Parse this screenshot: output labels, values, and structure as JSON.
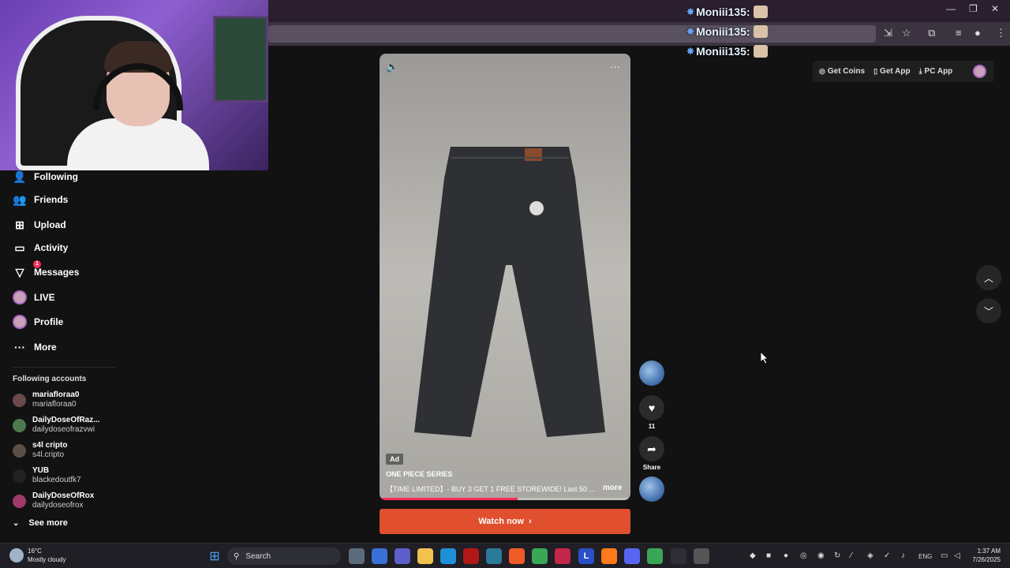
{
  "chat": {
    "lines": [
      {
        "user": "Moniii135:"
      },
      {
        "user": "Moniii135:"
      },
      {
        "user": "Moniii135:"
      }
    ]
  },
  "sidebar": {
    "items": [
      {
        "label": "Following",
        "icon": "person-check-icon"
      },
      {
        "label": "Friends",
        "icon": "friends-icon"
      },
      {
        "label": "Upload",
        "icon": "upload-icon"
      },
      {
        "label": "Activity",
        "icon": "activity-icon"
      },
      {
        "label": "Messages",
        "icon": "messages-icon",
        "badge": "1"
      },
      {
        "label": "LIVE",
        "icon": "live-icon"
      },
      {
        "label": "Profile",
        "icon": "profile-icon"
      },
      {
        "label": "More",
        "icon": "ellipsis-icon"
      }
    ],
    "following_label": "Following accounts",
    "accounts": [
      {
        "name": "mariafloraa0",
        "username": "mariafloraa0"
      },
      {
        "name": "DailyDoseOfRaz...",
        "username": "dailydoseofrazvwi"
      },
      {
        "name": "s4l cripto",
        "username": "s4l.cripto"
      },
      {
        "name": "YUB",
        "username": "blackedoutfk7"
      },
      {
        "name": "DailyDoseOfRox",
        "username": "dailydoseofrox"
      }
    ],
    "see_more": "See more"
  },
  "video": {
    "ad_label": "Ad",
    "title": "ONE PIECE SERIES",
    "description": "【TIME LIMITED】- BUY 3 GET 1 FREE STOREWIDE! Last 50 ...",
    "more": "more",
    "progress": 0.55,
    "cta": "Watch now"
  },
  "actions": {
    "like_count": "11",
    "share_label": "Share"
  },
  "topbar": {
    "get_coins": "Get Coins",
    "get_app": "Get App",
    "pc_app": "PC App"
  },
  "taskbar": {
    "weather_temp": "16°C",
    "weather_desc": "Mostly cloudy",
    "search_label": "Search",
    "lang": "ENG",
    "time": "1:37 AM",
    "date": "7/26/2025"
  },
  "colors": {
    "accent": "#fe2c55",
    "cta": "#e0502f",
    "background": "#121212"
  }
}
